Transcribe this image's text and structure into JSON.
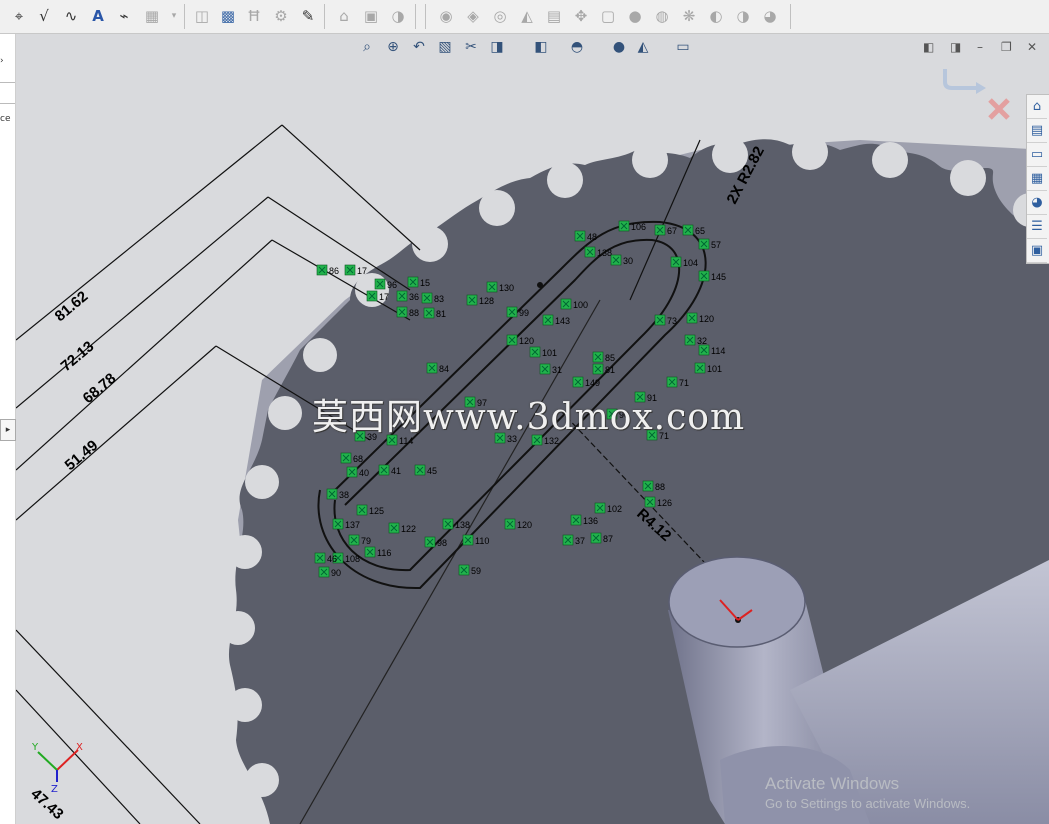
{
  "toolbar": {
    "groups": [
      {
        "items": [
          "smart-dimension",
          "add-relation",
          "spline",
          "text",
          "convert-entities",
          "table"
        ]
      },
      {
        "items": [
          "insert-block",
          "make-block",
          "explode-block",
          "save-block",
          "rebuild-block"
        ]
      },
      {
        "items": [
          "home",
          "sketch-picture",
          "rapid-sketch"
        ]
      },
      {
        "items": [
          "shaded-sketch",
          "instant-3d",
          "offset",
          "mirror",
          "pattern",
          "move",
          "copy",
          "rotate",
          "scale",
          "stretch",
          "trim",
          "extend"
        ]
      }
    ]
  },
  "left_panel": {
    "label_top": "ce"
  },
  "dimensions": {
    "d1": "81.62",
    "d2": "72.13",
    "d3": "68.78",
    "d4": "51.49",
    "diag": "2X R2.82",
    "radius": "R4.12",
    "bottom": "47.43"
  },
  "relation_numbers": [
    "86",
    "17",
    "96",
    "15",
    "17",
    "36",
    "83",
    "88",
    "81",
    "128",
    "130",
    "99",
    "100",
    "143",
    "120",
    "101",
    "84",
    "31",
    "81",
    "85",
    "91",
    "90",
    "149",
    "71",
    "97",
    "33",
    "132",
    "136",
    "102",
    "88",
    "126",
    "120",
    "138",
    "87",
    "37",
    "59",
    "98",
    "110",
    "122",
    "116",
    "79",
    "137",
    "108",
    "46",
    "90",
    "125",
    "41",
    "40",
    "38",
    "68",
    "39",
    "45",
    "114",
    "73",
    "120",
    "32",
    "101",
    "71",
    "114",
    "106",
    "65",
    "57",
    "104",
    "145",
    "138",
    "48",
    "30",
    "67"
  ],
  "triad": {
    "x": "X",
    "y": "Y",
    "z": "Z"
  },
  "watermark": "莫西网www.3dmox.com",
  "activation": {
    "title": "Activate Windows",
    "subtitle": "Go to Settings to activate Windows."
  },
  "colors": {
    "background": "#d9dadd",
    "gear_face": "#5b5e6a",
    "gear_side": "#9ea0ae",
    "relation_marker": "#22b24c",
    "cylinder": "#9c9fb6"
  }
}
